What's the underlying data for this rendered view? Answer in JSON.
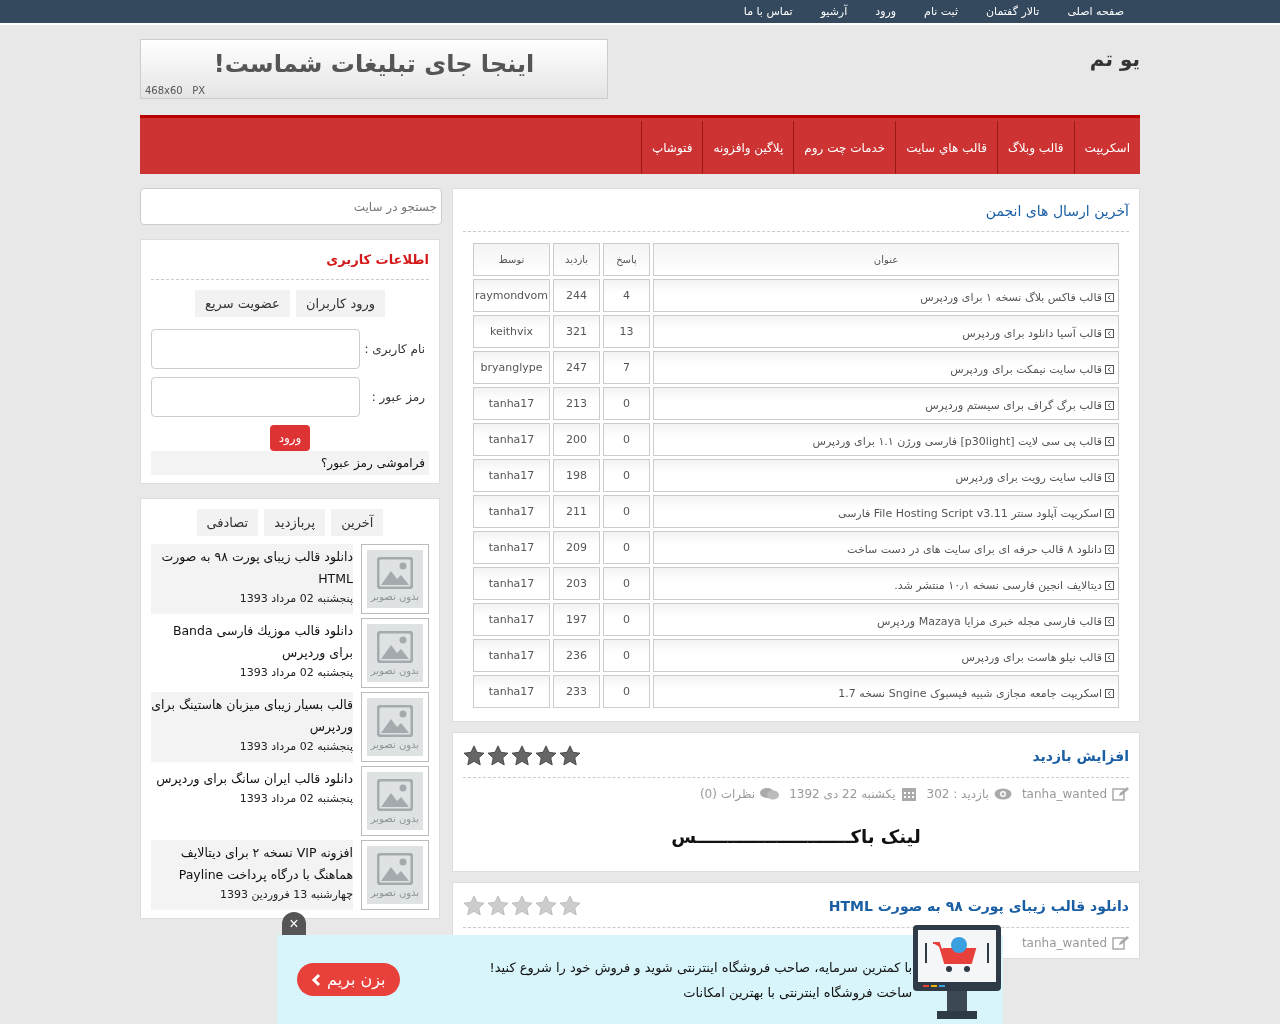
{
  "top_menu": [
    "صفحه اصلی",
    "تالار گفتمان",
    "ثبت نام",
    "ورود",
    "آرشیو",
    "تماس با ما"
  ],
  "logo": "یو تم",
  "ad_banner": {
    "text": "اینجا جای تبلیغات شماست!",
    "size": "468x60   PX"
  },
  "nav": [
    "اسکریپت",
    "قالب وبلاگ",
    "قالب هاي سايت",
    "خدمات چت روم",
    "پلاگین وافزونه",
    "فتوشاپ"
  ],
  "forum": {
    "title": "آخرین ارسال های انجمن",
    "columns": [
      "عنوان",
      "پاسخ",
      "بازدید",
      "توسط"
    ],
    "rows": [
      {
        "title": "قالب فاکس بلاگ نسخه ۱ برای وردپرس",
        "replies": "4",
        "views": "244",
        "by": "raymondvom"
      },
      {
        "title": "قالب آسیا دانلود برای وردپرس",
        "replies": "13",
        "views": "321",
        "by": "keithvix"
      },
      {
        "title": "قالب سایت نیمکت برای وردپرس",
        "replies": "7",
        "views": "247",
        "by": "bryanglype"
      },
      {
        "title": "قالب برگ گراف برای سیستم وردپرس",
        "replies": "0",
        "views": "213",
        "by": "tanha17"
      },
      {
        "title": "قالب پی سی لایت [p30light] فارسی ورژن ۱.۱ برای وردپرس",
        "replies": "0",
        "views": "200",
        "by": "tanha17"
      },
      {
        "title": "قالب سایت رویت برای وردپرس",
        "replies": "0",
        "views": "198",
        "by": "tanha17"
      },
      {
        "title": "اسکریپت آپلود سنتر File Hosting Script v3.11 فارسی",
        "replies": "0",
        "views": "211",
        "by": "tanha17"
      },
      {
        "title": "دانلود ۸ قالب حرفه ای برای سایت های در دست ساخت",
        "replies": "0",
        "views": "209",
        "by": "tanha17"
      },
      {
        "title": "دیتالایف انجین فارسی نسخه ۱۰٫۱ منتشر شد.",
        "replies": "0",
        "views": "203",
        "by": "tanha17"
      },
      {
        "title": "قالب فارسی مجله خبری مزایا Mazaya وردپرس",
        "replies": "0",
        "views": "197",
        "by": "tanha17"
      },
      {
        "title": "قالب نیلو هاست برای وردپرس",
        "replies": "0",
        "views": "236",
        "by": "tanha17"
      },
      {
        "title": "اسکریپت جامعه مجازی شبیه فیسبوک Sngine نسخه 1.7",
        "replies": "0",
        "views": "233",
        "by": "tanha17"
      }
    ]
  },
  "posts": [
    {
      "title": "افزایش بازدید",
      "stars": 5,
      "meta": [
        {
          "kind": "author",
          "text": "tanha_wanted"
        },
        {
          "kind": "views",
          "text": "بازدید : 302"
        },
        {
          "kind": "date",
          "text": "یکشنبه 22 دی 1392"
        },
        {
          "kind": "comments",
          "text": "نظرات (0)"
        }
      ],
      "body": "لینک باکـــــــــــــــــــــــــس"
    },
    {
      "title": "دانلود قالب زیبای پورت ۹۸ به صورت HTML",
      "stars": 0,
      "meta": [
        {
          "kind": "author",
          "text": "tanha_wanted"
        }
      ]
    }
  ],
  "search": {
    "placeholder": "جستجو در سایت"
  },
  "user_box": {
    "title": "اطلاعات کاربری",
    "tabs": [
      "ورود کاربران",
      "عضویت سریع"
    ],
    "username_label": "نام کاربری :",
    "password_label": "رمز عبور :",
    "login_button": "ورود",
    "forgot": "فراموشی رمز عبور؟"
  },
  "sidebar_posts": {
    "tabs": [
      "آخرین",
      "پربازدید",
      "تصادفی"
    ],
    "items": [
      {
        "title": "دانلود قالب زیبای پورت ۹۸ به صورت HTML",
        "date": "پنجشنبه 02 مرداد 1393",
        "no_image": "بدون تصویر"
      },
      {
        "title": "دانلود قالب موزیك فارسی Banda برای وردپرس",
        "date": "پنجشنبه 02 مرداد 1393",
        "no_image": "بدون تصویر"
      },
      {
        "title": "قالب بسیار زیبای میزبان هاستینگ برای وردپرس",
        "date": "پنجشنبه 02 مرداد 1393",
        "no_image": "بدون تصویر"
      },
      {
        "title": "دانلود قالب ایران سانگ برای وردپرس",
        "date": "پنجشنبه 02 مرداد 1393",
        "no_image": "بدون تصویر"
      },
      {
        "title": "افزونه VIP نسخه ۲ برای دیتالایف هماهنگ با درگاه پرداخت Payline",
        "date": "چهارشنبه 13 فروردین 1393",
        "no_image": "بدون تصویر"
      }
    ]
  },
  "promo": {
    "line1": "با کمترین سرمایه، صاحب فروشگاه اینترنتی شوید و فروش خود را شروع کنید!",
    "line2": "ساخت فروشگاه اینترنتی با بهترین امکانات",
    "button": "بزن بریم",
    "close": "×"
  }
}
